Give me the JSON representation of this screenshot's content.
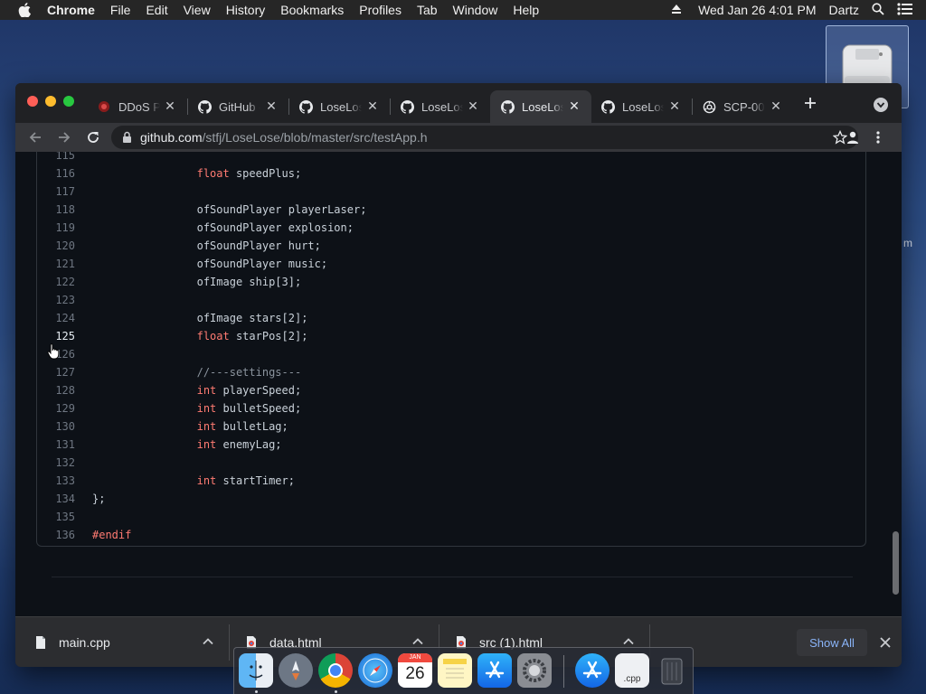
{
  "menubar": {
    "app": "Chrome",
    "items": [
      "File",
      "Edit",
      "View",
      "History",
      "Bookmarks",
      "Profiles",
      "Tab",
      "Window",
      "Help"
    ],
    "datetime": "Wed Jan 26  4:01 PM",
    "user": "Dartz"
  },
  "desktop": {
    "side_text": "m"
  },
  "tabs": [
    {
      "label": "DDoS Pr",
      "icon": "ddos-icon"
    },
    {
      "label": "GitHub -",
      "icon": "github-icon"
    },
    {
      "label": "LoseLos",
      "icon": "github-icon"
    },
    {
      "label": "LoseLos",
      "icon": "github-icon"
    },
    {
      "label": "LoseLos",
      "icon": "github-icon",
      "active": true
    },
    {
      "label": "LoseLos",
      "icon": "github-icon"
    },
    {
      "label": "SCP-00",
      "icon": "scp-icon"
    }
  ],
  "address": {
    "host": "github.com",
    "path": "/stfj/LoseLose/blob/master/src/testApp.h"
  },
  "code": {
    "current_line": "125",
    "lines": [
      {
        "n": "115",
        "indent": "",
        "kw": "",
        "text": ""
      },
      {
        "n": "116",
        "indent": "                ",
        "kw": "float",
        "text": " speedPlus;"
      },
      {
        "n": "117",
        "indent": "",
        "kw": "",
        "text": ""
      },
      {
        "n": "118",
        "indent": "                ",
        "kw": "",
        "text": "ofSoundPlayer playerLaser;"
      },
      {
        "n": "119",
        "indent": "                ",
        "kw": "",
        "text": "ofSoundPlayer explosion;"
      },
      {
        "n": "120",
        "indent": "                ",
        "kw": "",
        "text": "ofSoundPlayer hurt;"
      },
      {
        "n": "121",
        "indent": "                ",
        "kw": "",
        "text": "ofSoundPlayer music;"
      },
      {
        "n": "122",
        "indent": "                ",
        "kw": "",
        "text": "ofImage ship[3];"
      },
      {
        "n": "123",
        "indent": "",
        "kw": "",
        "text": ""
      },
      {
        "n": "124",
        "indent": "                ",
        "kw": "",
        "text": "ofImage stars[2];"
      },
      {
        "n": "125",
        "indent": "                ",
        "kw": "float",
        "text": " starPos[2];"
      },
      {
        "n": "126",
        "indent": "",
        "kw": "",
        "text": ""
      },
      {
        "n": "127",
        "indent": "                ",
        "kw": "",
        "text": "//---settings---",
        "comment": true
      },
      {
        "n": "128",
        "indent": "                ",
        "kw": "int",
        "text": " playerSpeed;"
      },
      {
        "n": "129",
        "indent": "                ",
        "kw": "int",
        "text": " bulletSpeed;"
      },
      {
        "n": "130",
        "indent": "                ",
        "kw": "int",
        "text": " bulletLag;"
      },
      {
        "n": "131",
        "indent": "                ",
        "kw": "int",
        "text": " enemyLag;"
      },
      {
        "n": "132",
        "indent": "",
        "kw": "",
        "text": ""
      },
      {
        "n": "133",
        "indent": "                ",
        "kw": "int",
        "text": " startTimer;"
      },
      {
        "n": "134",
        "indent": "",
        "kw": "",
        "text": "};"
      },
      {
        "n": "135",
        "indent": "",
        "kw": "",
        "text": ""
      },
      {
        "n": "136",
        "indent": "",
        "kw": "#endif",
        "text": ""
      }
    ]
  },
  "downloads": {
    "items": [
      {
        "name": "main.cpp"
      },
      {
        "name": "data.html"
      },
      {
        "name": "src (1).html"
      }
    ],
    "show_all": "Show All"
  },
  "dock": {
    "calendar_month": "JAN",
    "calendar_day": "26",
    "cpp_label": ".cpp"
  },
  "colors": {
    "keyword": "#ff7b72",
    "code_bg": "#0d1117",
    "accent_link": "#8ab4f8"
  }
}
